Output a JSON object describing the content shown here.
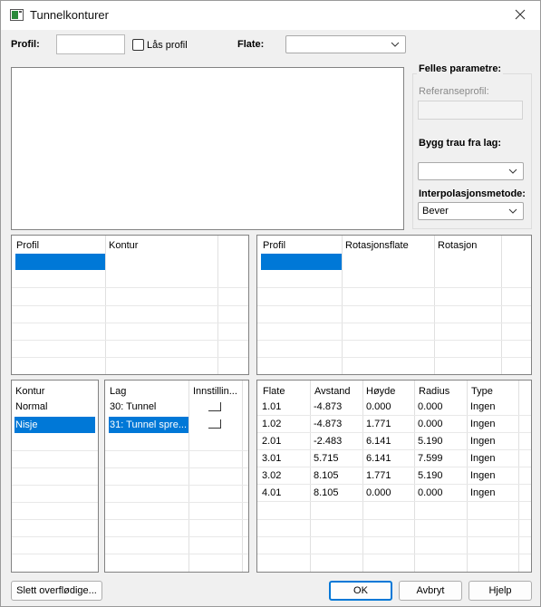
{
  "window": {
    "title": "Tunnelkonturer",
    "close_icon": "close-icon"
  },
  "top": {
    "profil_label": "Profil:",
    "profil_value": "",
    "lock_label": "Lås profil",
    "lock_checked": false,
    "flate_label": "Flate:",
    "flate_value": ""
  },
  "felles": {
    "title": "Felles parametre:",
    "referanse_label": "Referanseprofil:",
    "referanse_value": "",
    "bygg_label": "Bygg trau fra lag:",
    "bygg_value": "",
    "interp_label": "Interpolasjonsmetode:",
    "interp_value": "Bever"
  },
  "profil_kontur_table": {
    "headers": [
      "Profil",
      "Kontur"
    ],
    "selected_row": 0
  },
  "profil_rot_table": {
    "headers": [
      "Profil",
      "Rotasjonsflate",
      "Rotasjon"
    ],
    "selected_row": 0
  },
  "kontur_list": {
    "header": "Kontur",
    "rows": [
      "Normal",
      "Nisje"
    ],
    "selected_row": 1
  },
  "lag_table": {
    "headers": [
      "Lag",
      "Innstillin..."
    ],
    "rows": [
      {
        "lag": "30: Tunnel",
        "checked": false
      },
      {
        "lag": "31: Tunnel spre...",
        "checked": false
      }
    ],
    "selected_row": 1
  },
  "flate_table": {
    "headers": [
      "Flate",
      "Avstand",
      "Høyde",
      "Radius",
      "Type"
    ],
    "rows": [
      [
        "1.01",
        "-4.873",
        "0.000",
        "0.000",
        "Ingen"
      ],
      [
        "1.02",
        "-4.873",
        "1.771",
        "0.000",
        "Ingen"
      ],
      [
        "2.01",
        "-2.483",
        "6.141",
        "5.190",
        "Ingen"
      ],
      [
        "3.01",
        "5.715",
        "6.141",
        "7.599",
        "Ingen"
      ],
      [
        "3.02",
        "8.105",
        "1.771",
        "5.190",
        "Ingen"
      ],
      [
        "4.01",
        "8.105",
        "0.000",
        "0.000",
        "Ingen"
      ]
    ]
  },
  "buttons": {
    "slett": "Slett overflødige...",
    "ok": "OK",
    "avbryt": "Avbryt",
    "hjelp": "Hjelp"
  },
  "colors": {
    "selection": "#0078d7",
    "default_button_border": "#0078d7"
  }
}
